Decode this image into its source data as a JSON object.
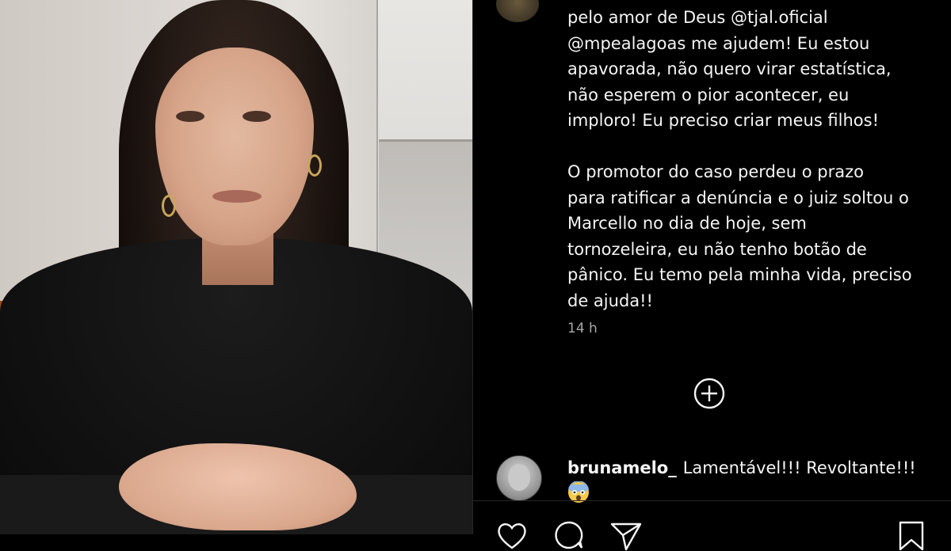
{
  "post": {
    "caption_lines": [
      "pelo amor de Deus @tjal.oficial",
      "@mpealagoas me ajudem! Eu estou",
      "apavorada, não quero virar estatística,",
      "não esperem o pior acontecer, eu",
      "imploro! Eu preciso criar meus filhos!",
      "",
      "O promotor do caso perdeu o prazo",
      "para ratificar a denúncia e o juiz soltou o",
      "Marcello no dia de hoje, sem",
      "tornozeleira, eu não tenho botão de",
      "pânico. Eu temo pela minha vida, preciso",
      "de ajuda!!"
    ],
    "time": "14 h"
  },
  "comment": {
    "username": "brunamelo_",
    "text": "Lamentável!!! Revoltante!!!",
    "emoji": "😨"
  },
  "icons": {
    "load_more": "plus-circle-icon",
    "like": "heart-icon",
    "comment": "comment-bubble-icon",
    "share": "paper-plane-icon",
    "save": "bookmark-icon"
  }
}
